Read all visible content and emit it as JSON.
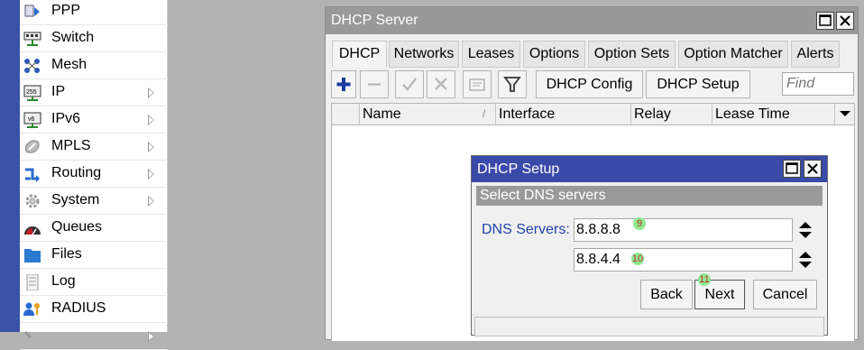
{
  "sidebar": {
    "items": [
      {
        "label": "PPP",
        "icon": "ppp-icon",
        "has_submenu": false
      },
      {
        "label": "Switch",
        "icon": "switch-icon",
        "has_submenu": false
      },
      {
        "label": "Mesh",
        "icon": "mesh-icon",
        "has_submenu": false
      },
      {
        "label": "IP",
        "icon": "ip-icon",
        "has_submenu": true,
        "icon_text": "255"
      },
      {
        "label": "IPv6",
        "icon": "ipv6-icon",
        "has_submenu": true,
        "icon_text": "v6"
      },
      {
        "label": "MPLS",
        "icon": "mpls-icon",
        "has_submenu": true
      },
      {
        "label": "Routing",
        "icon": "routing-icon",
        "has_submenu": true
      },
      {
        "label": "System",
        "icon": "system-gear-icon",
        "has_submenu": true
      },
      {
        "label": "Queues",
        "icon": "queues-icon",
        "has_submenu": false
      },
      {
        "label": "Files",
        "icon": "files-folder-icon",
        "has_submenu": false
      },
      {
        "label": "Log",
        "icon": "log-icon",
        "has_submenu": false
      },
      {
        "label": "RADIUS",
        "icon": "radius-users-icon",
        "has_submenu": false
      },
      {
        "label": "",
        "icon": "tools-icon",
        "has_submenu": true
      }
    ]
  },
  "dhcp_window": {
    "title": "DHCP Server",
    "tabs": [
      {
        "label": "DHCP",
        "active": true
      },
      {
        "label": "Networks",
        "active": false
      },
      {
        "label": "Leases",
        "active": false
      },
      {
        "label": "Options",
        "active": false
      },
      {
        "label": "Option Sets",
        "active": false
      },
      {
        "label": "Option Matcher",
        "active": false
      },
      {
        "label": "Alerts",
        "active": false
      }
    ],
    "toolbar": {
      "dhcp_config_label": "DHCP Config",
      "dhcp_setup_label": "DHCP Setup",
      "find_placeholder": "Find"
    },
    "columns": [
      "Name",
      "Interface",
      "Relay",
      "Lease Time"
    ]
  },
  "setup_dialog": {
    "title": "DHCP Setup",
    "subtitle": "Select DNS servers",
    "dns_label": "DNS Servers:",
    "dns_values": [
      "8.8.8.8",
      "8.8.4.4"
    ],
    "back_label": "Back",
    "next_label": "Next",
    "cancel_label": "Cancel"
  },
  "markers": [
    "9",
    "10",
    "11"
  ],
  "colors": {
    "accent_blue": "#3a4aa8",
    "label_blue": "#2244aa",
    "titlebar_gray": "#999999",
    "add_button_blue": "#1a3aa0",
    "marker_green": "#8fe88f"
  }
}
